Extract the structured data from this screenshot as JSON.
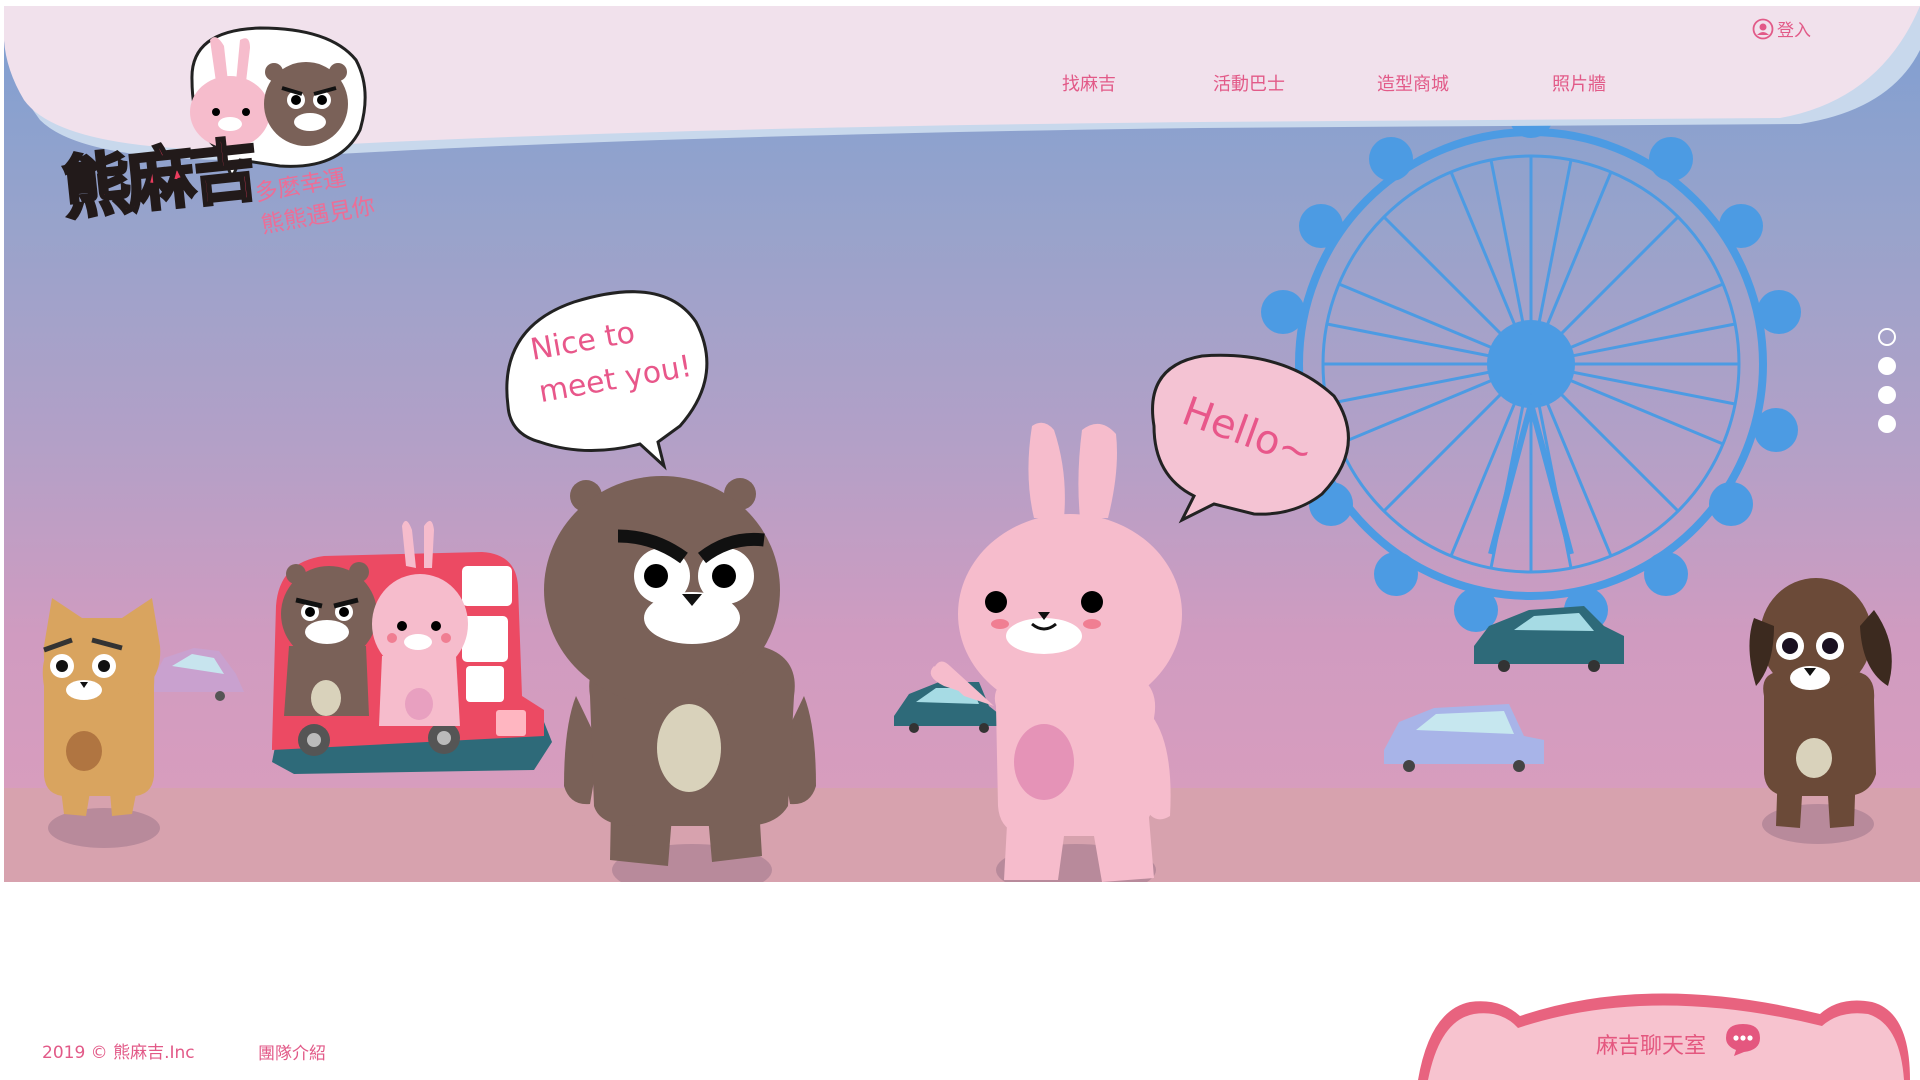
{
  "brand": {
    "logo_text": "熊麻吉",
    "slogan_line1": "多麼幸運",
    "slogan_line2": "熊熊遇見你"
  },
  "header": {
    "login_label": "登入",
    "nav": [
      {
        "label": "找麻吉"
      },
      {
        "label": "活動巴士"
      },
      {
        "label": "造型商城"
      },
      {
        "label": "照片牆"
      }
    ]
  },
  "hero": {
    "bear_bubble_line1": "Nice to",
    "bear_bubble_line2": "meet you!",
    "bunny_bubble": "Hello~",
    "slides": {
      "count": 4,
      "active_index": 0
    }
  },
  "footer": {
    "copyright": "2019 © 熊麻吉.Inc",
    "team_link": "團隊介紹"
  },
  "chat": {
    "label": "麻吉聊天室",
    "icon": "chat-bubble-icon"
  },
  "colors": {
    "accent": "#e25a88",
    "header_band": "#f1e1ec",
    "ferris_wheel": "#4c9be3",
    "bear": "#7a6158",
    "bunny": "#f6bccc",
    "chat_tab": "#f7c3cf"
  }
}
